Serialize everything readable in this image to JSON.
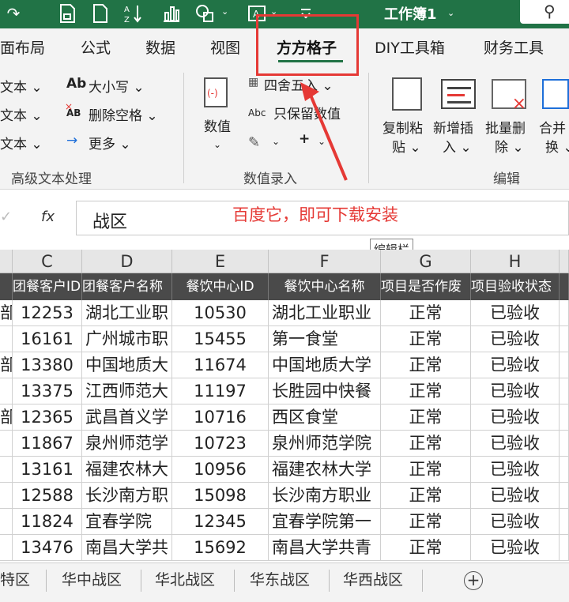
{
  "titlebar": {
    "workbook_title": "工作簿1",
    "caret": "⌄",
    "color": "#217346"
  },
  "tabs": {
    "items": [
      "面布局",
      "公式",
      "数据",
      "视图",
      "方方格子",
      "DIY工具箱",
      "财务工具"
    ],
    "active": "方方格子",
    "highlight_color": "#e53935"
  },
  "ribbon": {
    "left_col": [
      "文本 ⌄",
      "文本 ⌄",
      "文本 ⌄"
    ],
    "mid_col": [
      "大小写 ⌄",
      "删除空格 ⌄",
      "更多 ⌄"
    ],
    "mid_icons": [
      "Ab",
      "AB",
      "→"
    ],
    "value_button": "数值",
    "value_caret": "⌄",
    "four_round": "四舍五入 ⌄",
    "keep_value": "只保留数值",
    "keep_value_icon": "Abc",
    "plus": "+",
    "right_buttons": [
      {
        "line1": "复制粘",
        "line2": "贴 ⌄"
      },
      {
        "line1": "新增插",
        "line2": "入 ⌄"
      },
      {
        "line1": "批量删",
        "line2": "除 ⌄"
      },
      {
        "line1": "合并",
        "line2": "换 ⌄"
      }
    ],
    "groups": [
      "高级文本处理",
      "数值录入",
      "编辑"
    ]
  },
  "formula_bar": {
    "fx": "fx",
    "value": "战区",
    "annotation": "百度它，即可下载安装",
    "tooltip": "编辑栏"
  },
  "grid": {
    "columns": [
      "C",
      "D",
      "E",
      "F",
      "G",
      "H"
    ],
    "headers": [
      "团餐客户ID",
      "团餐客户名称",
      "餐饮中心ID",
      "餐饮中心名称",
      "项目是否作废",
      "项目验收状态"
    ],
    "rows": [
      {
        "b": "部",
        "c": "12253",
        "d": "湖北工业职",
        "e": "10530",
        "f": "湖北工业职业",
        "g": "正常",
        "h": "已验收"
      },
      {
        "b": "",
        "c": "16161",
        "d": "广州城市职",
        "e": "15455",
        "f": "第一食堂",
        "g": "正常",
        "h": "已验收"
      },
      {
        "b": "部",
        "c": "13380",
        "d": "中国地质大",
        "e": "11674",
        "f": "中国地质大学",
        "g": "正常",
        "h": "已验收"
      },
      {
        "b": "",
        "c": "13375",
        "d": "江西师范大",
        "e": "11197",
        "f": "长胜园中快餐",
        "g": "正常",
        "h": "已验收"
      },
      {
        "b": "部",
        "c": "12365",
        "d": "武昌首义学",
        "e": "10716",
        "f": "西区食堂",
        "g": "正常",
        "h": "已验收"
      },
      {
        "b": "",
        "c": "11867",
        "d": "泉州师范学",
        "e": "10723",
        "f": "泉州师范学院",
        "g": "正常",
        "h": "已验收"
      },
      {
        "b": "",
        "c": "13161",
        "d": "福建农林大",
        "e": "10956",
        "f": "福建农林大学",
        "g": "正常",
        "h": "已验收"
      },
      {
        "b": "",
        "c": "12588",
        "d": "长沙南方职",
        "e": "15098",
        "f": "长沙南方职业",
        "g": "正常",
        "h": "已验收"
      },
      {
        "b": "",
        "c": "11824",
        "d": "宜春学院",
        "e": "12345",
        "f": "宜春学院第一",
        "g": "正常",
        "h": "已验收"
      },
      {
        "b": "",
        "c": "13476",
        "d": "南昌大学共",
        "e": "15692",
        "f": "南昌大学共青",
        "g": "正常",
        "h": "已验收"
      }
    ]
  },
  "sheets": {
    "tabs": [
      "特区",
      "华中战区",
      "华北战区",
      "华东战区",
      "华西战区"
    ],
    "add": "+"
  }
}
